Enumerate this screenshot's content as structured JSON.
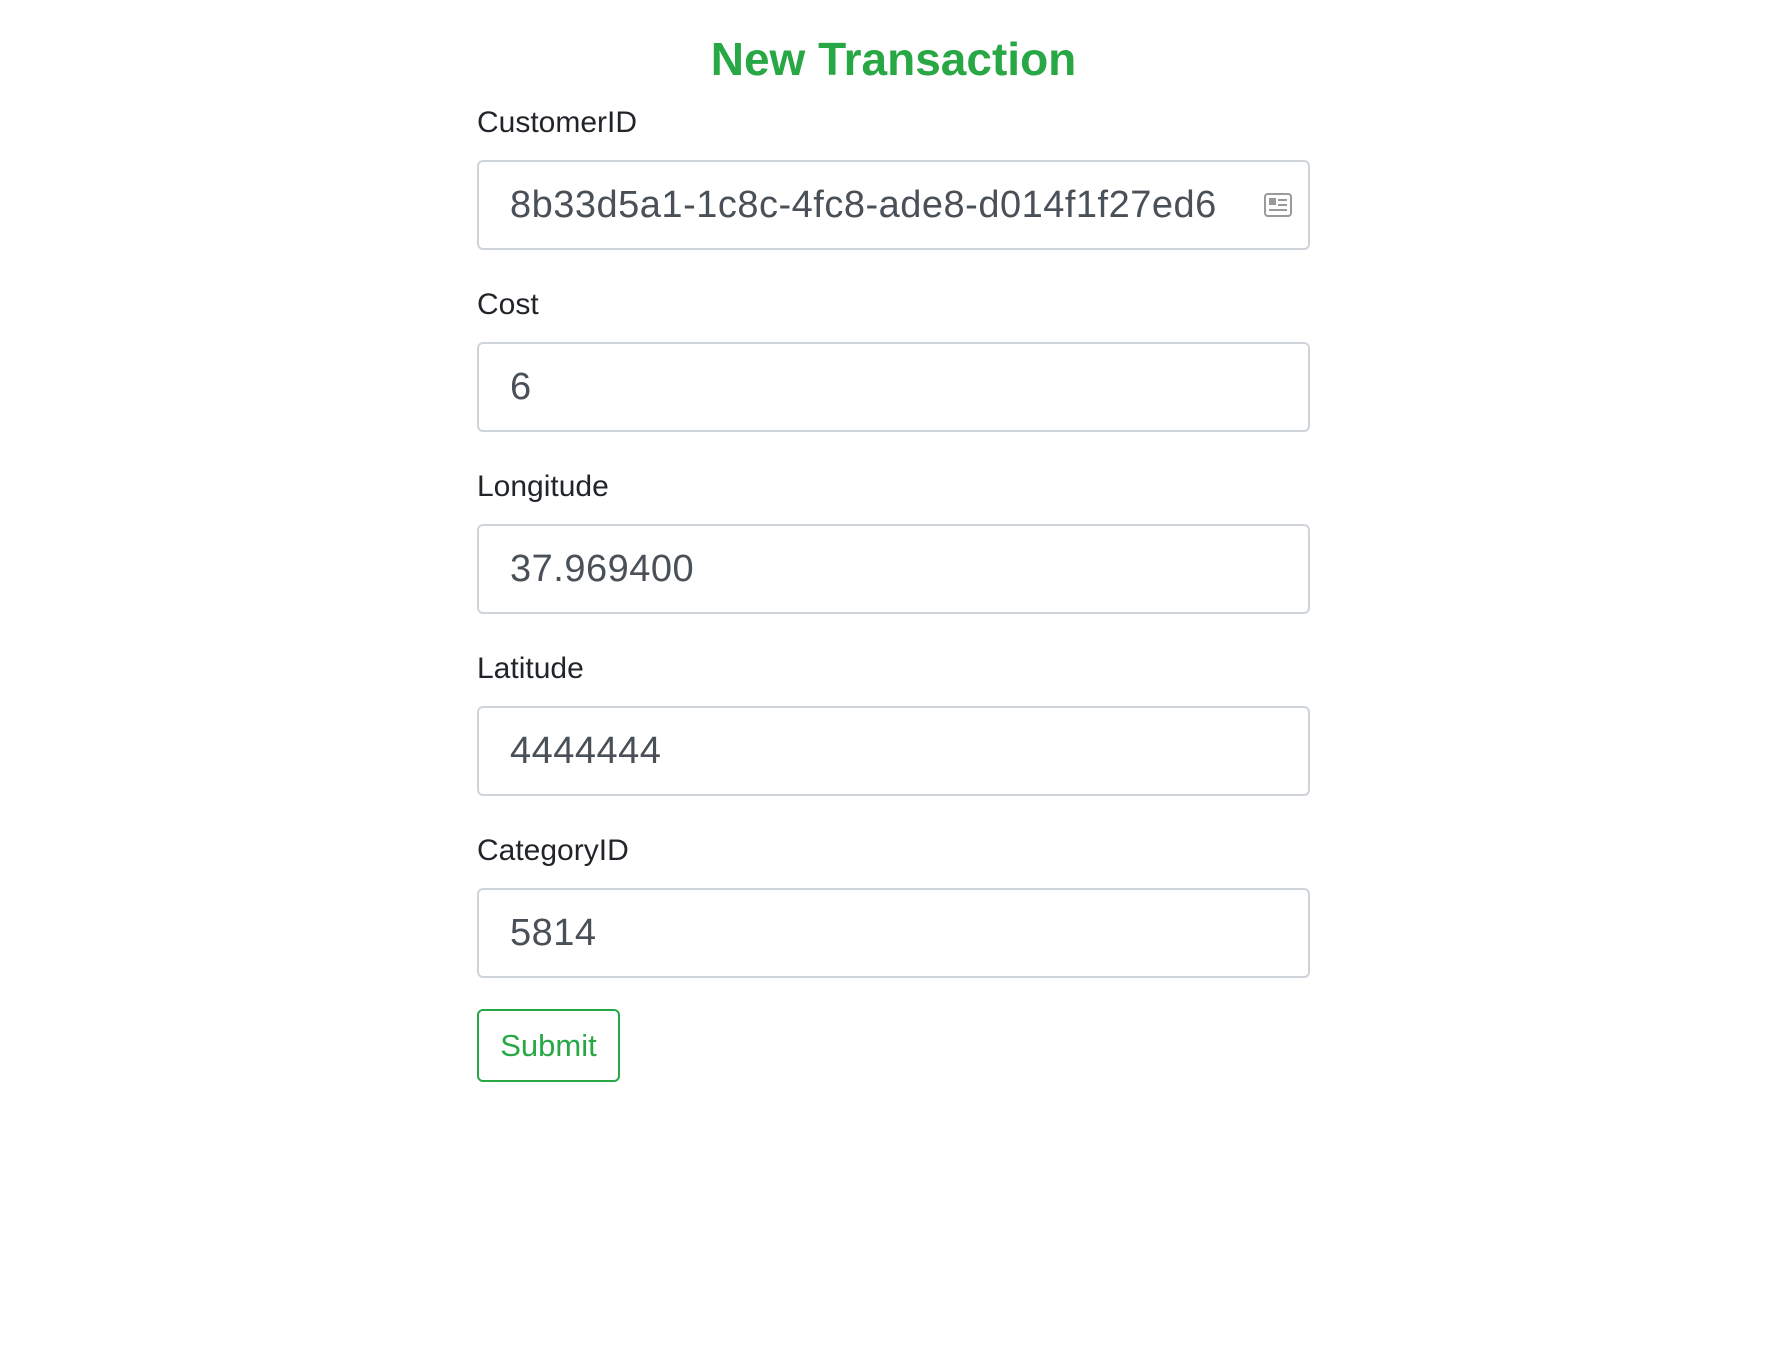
{
  "page": {
    "title": "New Transaction"
  },
  "form": {
    "fields": [
      {
        "label": "CustomerID",
        "value": "8b33d5a1-1c8c-4fc8-ade8-d014f1f27ed6"
      },
      {
        "label": "Cost",
        "value": "6"
      },
      {
        "label": "Longitude",
        "value": "37.969400"
      },
      {
        "label": "Latitude",
        "value": "4444444"
      },
      {
        "label": "CategoryID",
        "value": "5814"
      }
    ],
    "submit_label": "Submit",
    "autofill_icon": "contact-card-icon"
  },
  "colors": {
    "accent": "#28a745",
    "input_border": "#ced4da",
    "input_text": "#495057",
    "label_text": "#212529"
  }
}
